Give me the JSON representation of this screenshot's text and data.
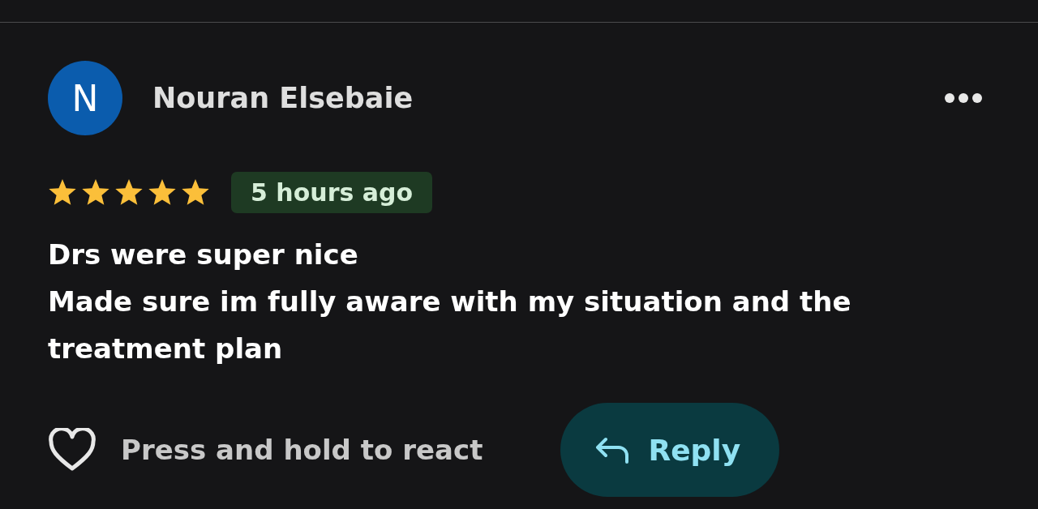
{
  "review": {
    "avatar_letter": "N",
    "author": "Nouran Elsebaie",
    "stars": 5,
    "time": "5 hours ago",
    "text": "Drs were super nice\nMade sure im fully aware with my situation and the treatment plan"
  },
  "actions": {
    "react_hint": "Press and hold to react",
    "reply": "Reply"
  }
}
